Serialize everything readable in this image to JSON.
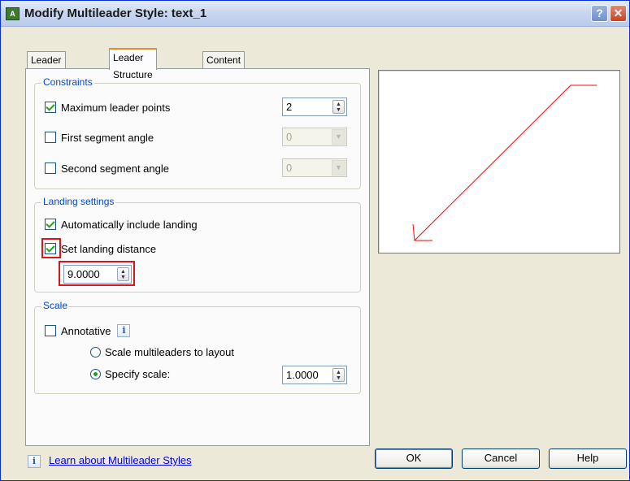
{
  "window": {
    "title": "Modify Multileader Style: text_1",
    "help_glyph": "?",
    "close_glyph": "✕"
  },
  "tabs": [
    {
      "label": "Leader Format",
      "active": false
    },
    {
      "label": "Leader Structure",
      "active": true
    },
    {
      "label": "Content",
      "active": false
    }
  ],
  "constraints": {
    "legend": "Constraints",
    "max_leader_points": {
      "label": "Maximum leader points",
      "checked": true,
      "value": "2"
    },
    "first_segment_angle": {
      "label": "First segment angle",
      "checked": false,
      "value": "0"
    },
    "second_segment_angle": {
      "label": "Second segment angle",
      "checked": false,
      "value": "0"
    }
  },
  "landing": {
    "legend": "Landing settings",
    "auto_include": {
      "label": "Automatically include landing",
      "checked": true
    },
    "set_distance": {
      "label": "Set landing distance",
      "checked": true,
      "value": "9.0000"
    }
  },
  "scale": {
    "legend": "Scale",
    "annotative": {
      "label": "Annotative",
      "checked": false
    },
    "option_layout": {
      "label": "Scale multileaders to layout",
      "selected": false
    },
    "option_specify": {
      "label": "Specify scale:",
      "selected": true,
      "value": "1.0000"
    }
  },
  "footer": {
    "info_glyph": "i",
    "link": "Learn about Multileader Styles"
  },
  "buttons": {
    "ok": "OK",
    "cancel": "Cancel",
    "help": "Help"
  },
  "colors": {
    "leader_line": "#ff0000",
    "highlight": "#d9141a",
    "check": "#21a121",
    "group_label": "#0046d5"
  }
}
